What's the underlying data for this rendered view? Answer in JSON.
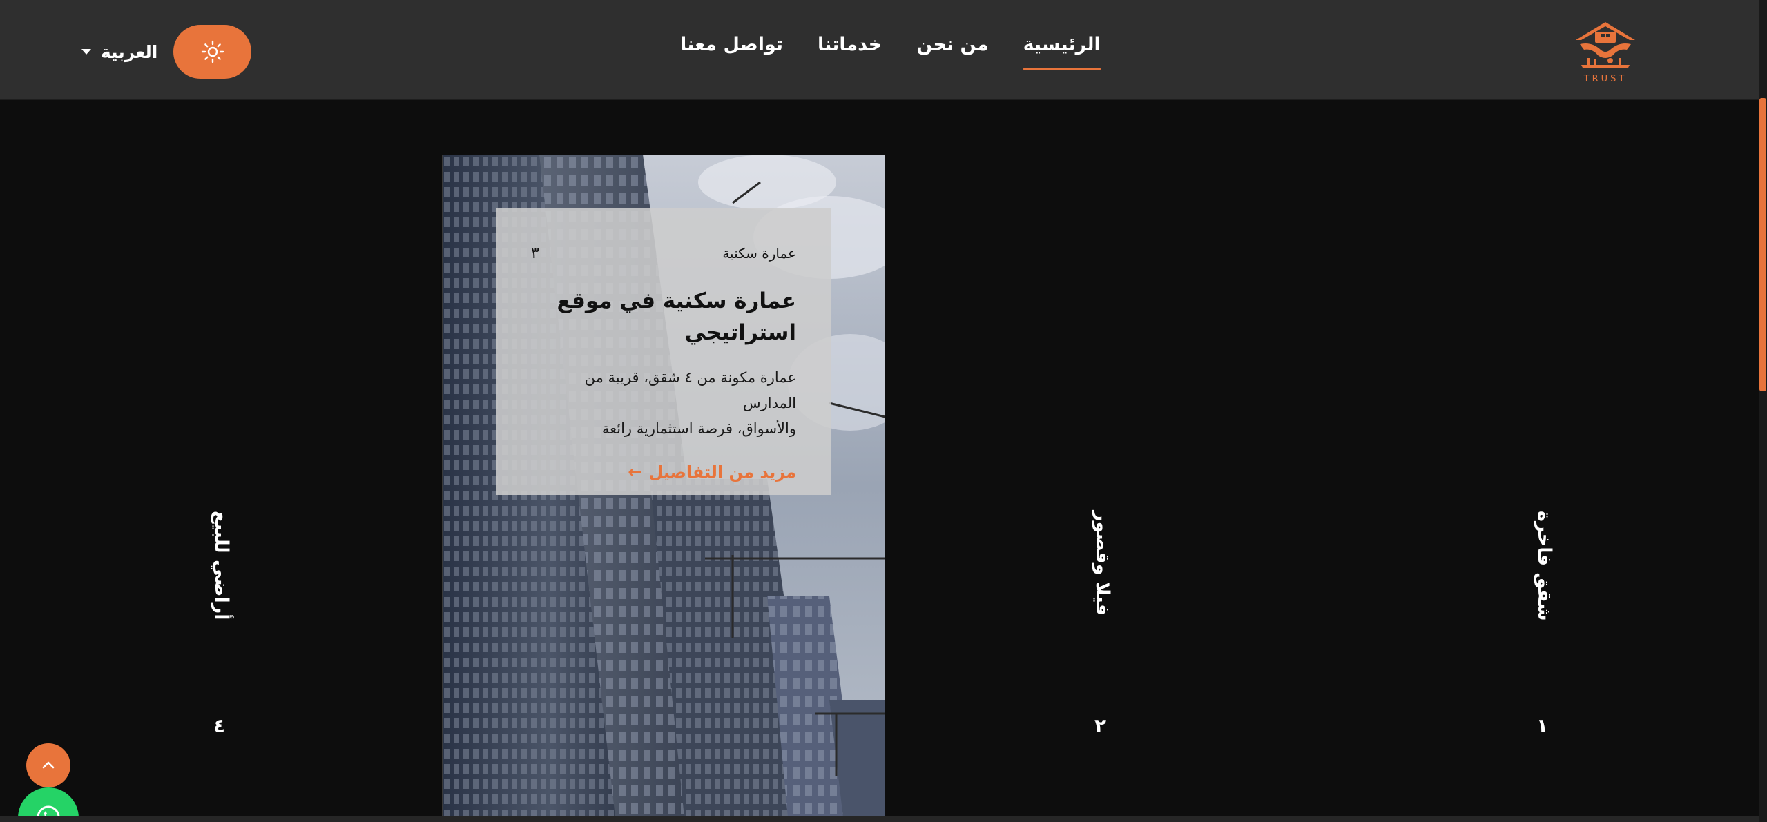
{
  "brand": {
    "logo_text": "الثقة",
    "logo_subtext": "TRUST"
  },
  "nav": {
    "items": [
      {
        "label": "الرئيسية",
        "active": true
      },
      {
        "label": "من نحن",
        "active": false
      },
      {
        "label": "خدماتنا",
        "active": false
      },
      {
        "label": "تواصل معنا",
        "active": false
      }
    ]
  },
  "header": {
    "language": "العربية",
    "theme_icon": "sun-icon"
  },
  "slider": {
    "items": [
      {
        "label": "شقق فاخرة",
        "number": "١"
      },
      {
        "label": "فيلا وقصور",
        "number": "٢"
      },
      {
        "label": "أراضي للبيع",
        "number": "٤"
      }
    ],
    "active": {
      "category": "عمارة سكنية",
      "number": "٣",
      "title_line1": "عمارة سكنية في موقع",
      "title_line2": "استراتيجي",
      "desc_line1": "عمارة مكونة من ٤ شقق، قريبة من المدارس",
      "desc_line2": "والأسواق، فرصة استثمارية رائعة",
      "link": "مزيد من التفاصيل"
    }
  },
  "colors": {
    "accent": "#e8743b",
    "header_bg": "#2f2f2f",
    "page_bg": "#0d0d0d",
    "whatsapp": "#25d366"
  }
}
